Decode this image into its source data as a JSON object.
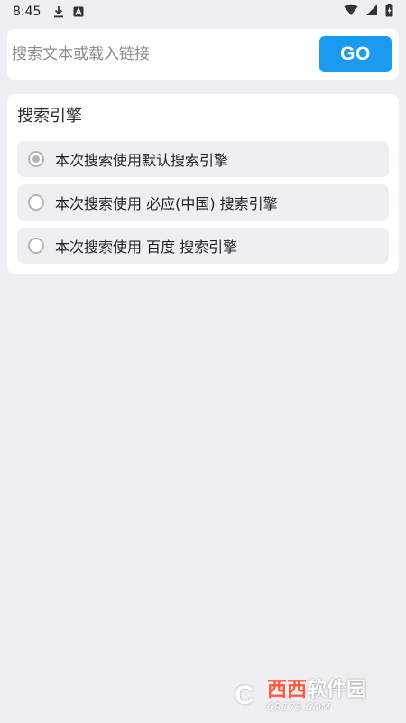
{
  "status_bar": {
    "time": "8:45",
    "icons_left": [
      "download-icon",
      "a-box-icon"
    ],
    "icons_right": [
      "wifi-icon",
      "signal-icon",
      "battery-charging-icon"
    ]
  },
  "search": {
    "placeholder": "搜索文本或载入链接",
    "value": "",
    "go_label": "GO",
    "go_color": "#1a9bf0"
  },
  "engine": {
    "title": "搜索引擎",
    "options": [
      {
        "label": "本次搜索使用默认搜索引擎",
        "selected": true
      },
      {
        "label": "本次搜索使用 必应(中国) 搜索引擎",
        "selected": false
      },
      {
        "label": "本次搜索使用 百度 搜索引擎",
        "selected": false
      }
    ]
  },
  "watermark": {
    "badge": "C",
    "brand_red": "西西",
    "brand_white": "软件园",
    "url": "CR173.COM"
  }
}
